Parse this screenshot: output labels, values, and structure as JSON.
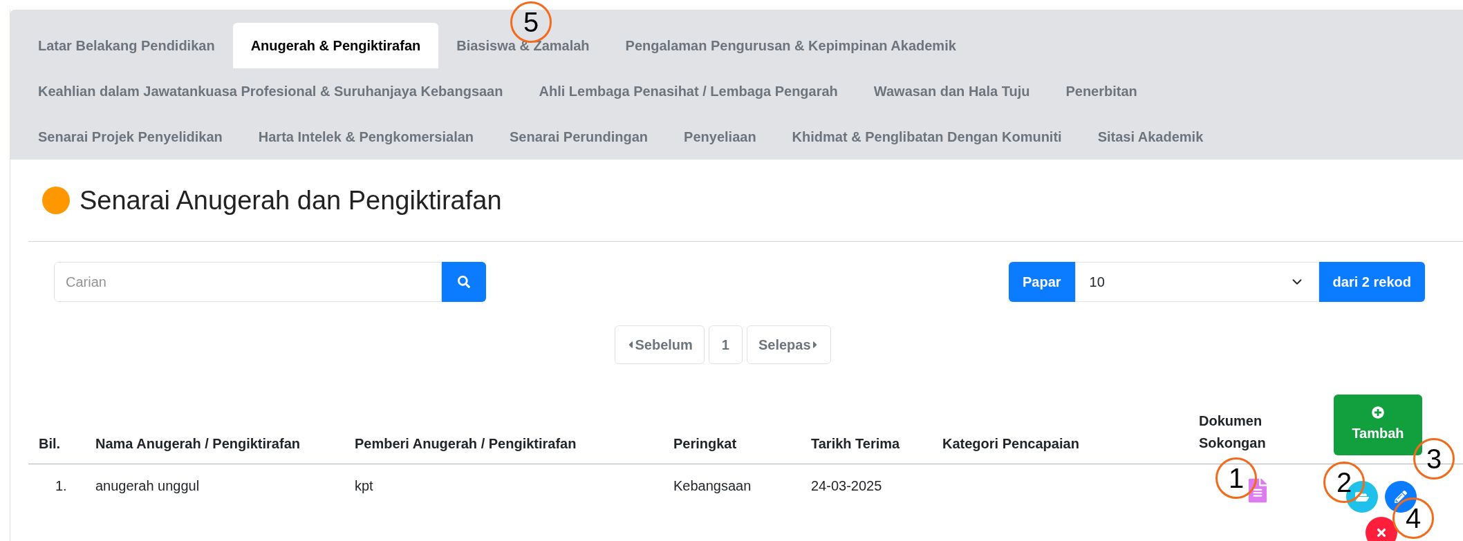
{
  "tab_rows": [
    [
      {
        "label": "Latar Belakang Pendidikan",
        "selected": false
      },
      {
        "label": "Anugerah & Pengiktirafan",
        "selected": true
      },
      {
        "label": "Biasiswa & Zamalah",
        "selected": false
      },
      {
        "label": "Pengalaman Pengurusan & Kepimpinan Akademik",
        "selected": false
      }
    ],
    [
      {
        "label": "Keahlian dalam Jawatankuasa Profesional & Suruhanjaya Kebangsaan",
        "selected": false
      },
      {
        "label": "Ahli Lembaga Penasihat / Lembaga Pengarah",
        "selected": false
      },
      {
        "label": "Wawasan dan Hala Tuju",
        "selected": false
      },
      {
        "label": "Penerbitan",
        "selected": false
      }
    ],
    [
      {
        "label": "Senarai Projek Penyelidikan",
        "selected": false
      },
      {
        "label": "Harta Intelek & Pengkomersialan",
        "selected": false
      },
      {
        "label": "Senarai Perundingan",
        "selected": false
      },
      {
        "label": "Penyeliaan",
        "selected": false
      },
      {
        "label": "Khidmat & Penglibatan Dengan Komuniti",
        "selected": false
      },
      {
        "label": "Sitasi Akademik",
        "selected": false
      }
    ]
  ],
  "title": "Senarai Anugerah dan Pengiktirafan",
  "search": {
    "placeholder": "Carian"
  },
  "page_size": {
    "label": "Papar",
    "value": "10",
    "suffix": "dari 2 rekod"
  },
  "pagination": {
    "prev": "Sebelum",
    "pages": [
      {
        "label": "1",
        "selected": false
      }
    ],
    "next": "Selepas"
  },
  "table": {
    "columns": [
      "Bil.",
      "Nama Anugerah / Pengiktirafan",
      "Pemberi Anugerah / Pengiktirafan",
      "Peringkat",
      "Tarikh Terima",
      "Kategori Pencapaian",
      "Dokumen Sokongan"
    ],
    "add_button": "Tambah",
    "rows": [
      {
        "cells": [
          "1.",
          "anugerah unggul",
          "kpt",
          "Kebangsaan",
          "24-03-2025",
          ""
        ],
        "has_document": true
      }
    ]
  },
  "callouts": [
    {
      "label": "1"
    },
    {
      "label": "2"
    },
    {
      "label": "3"
    },
    {
      "label": "4"
    },
    {
      "label": "5"
    }
  ]
}
